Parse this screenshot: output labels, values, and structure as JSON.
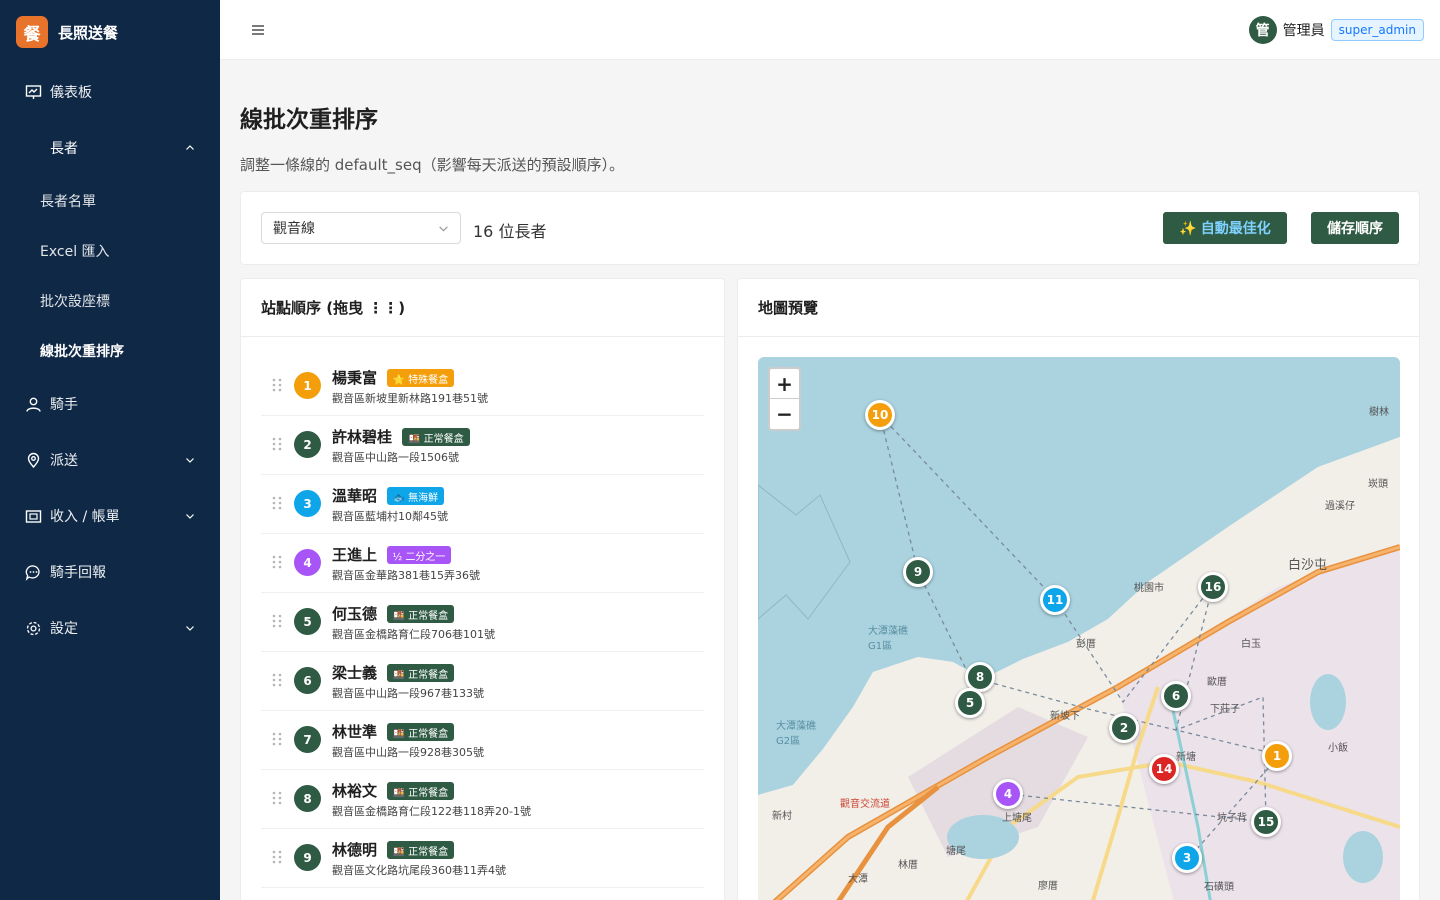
{
  "brand": {
    "logo_char": "餐",
    "name": "長照送餐"
  },
  "sidebar": {
    "dashboard": "儀表板",
    "elders_group": "長者",
    "elders_sub": [
      "長者名單",
      "Excel 匯入",
      "批次設座標",
      "線批次重排序"
    ],
    "riders": "騎手",
    "delivery": "派送",
    "billing": "收入 / 帳單",
    "rider_reports": "騎手回報",
    "settings": "設定"
  },
  "header": {
    "avatar_char": "管",
    "user_name": "管理員",
    "role": "super_admin"
  },
  "page": {
    "title": "線批次重排序",
    "description": "調整一條線的 default_seq（影響每天派送的預設順序）。"
  },
  "toolbar": {
    "route_select": "觀音線",
    "count_text": "16 位長者",
    "optimize_icon": "✨",
    "optimize_label": "自動最佳化",
    "save_label": "儲存順序"
  },
  "list_card": {
    "title": "站點順序 (拖曳 ⋮⋮)"
  },
  "stops": [
    {
      "seq": "1",
      "name": "楊秉富",
      "tag": "⭐ 特殊餐盒",
      "tag_color": "#f59e0b",
      "address": "觀音區新坡里新林路191巷51號",
      "color": "#f59e0b"
    },
    {
      "seq": "2",
      "name": "許林碧桂",
      "tag": "🍱 正常餐盒",
      "tag_color": "#2f5a43",
      "address": "觀音區中山路一段1506號",
      "color": "#2f5a43"
    },
    {
      "seq": "3",
      "name": "溫華昭",
      "tag": "🐟 無海鮮",
      "tag_color": "#0ea5e9",
      "address": "觀音區藍埔村10鄰45號",
      "color": "#0ea5e9"
    },
    {
      "seq": "4",
      "name": "王進上",
      "tag": "½ 二分之一",
      "tag_color": "#a855f7",
      "address": "觀音區金華路381巷15弄36號",
      "color": "#a855f7"
    },
    {
      "seq": "5",
      "name": "何玉德",
      "tag": "🍱 正常餐盒",
      "tag_color": "#2f5a43",
      "address": "觀音區金橋路育仁段706巷101號",
      "color": "#2f5a43"
    },
    {
      "seq": "6",
      "name": "梁士義",
      "tag": "🍱 正常餐盒",
      "tag_color": "#2f5a43",
      "address": "觀音區中山路一段967巷133號",
      "color": "#2f5a43"
    },
    {
      "seq": "7",
      "name": "林世準",
      "tag": "🍱 正常餐盒",
      "tag_color": "#2f5a43",
      "address": "觀音區中山路一段928巷305號",
      "color": "#2f5a43"
    },
    {
      "seq": "8",
      "name": "林裕文",
      "tag": "🍱 正常餐盒",
      "tag_color": "#2f5a43",
      "address": "觀音區金橋路育仁段122巷118弄20-1號",
      "color": "#2f5a43"
    },
    {
      "seq": "9",
      "name": "林德明",
      "tag": "🍱 正常餐盒",
      "tag_color": "#2f5a43",
      "address": "觀音區文化路坑尾段360巷11弄4號",
      "color": "#2f5a43"
    }
  ],
  "map_card": {
    "title": "地圖預覽",
    "zoom_in": "+",
    "zoom_out": "−"
  },
  "map_markers": [
    {
      "label": "10",
      "color": "#f59e0b"
    },
    {
      "label": "9",
      "color": "#2f5a43"
    },
    {
      "label": "11",
      "color": "#0ea5e9"
    },
    {
      "label": "16",
      "color": "#2f5a43"
    },
    {
      "label": "8",
      "color": "#2f5a43"
    },
    {
      "label": "5",
      "color": "#2f5a43"
    },
    {
      "label": "6",
      "color": "#2f5a43"
    },
    {
      "label": "2",
      "color": "#2f5a43"
    },
    {
      "label": "1",
      "color": "#f59e0b"
    },
    {
      "label": "14",
      "color": "#dc2626"
    },
    {
      "label": "4",
      "color": "#a855f7"
    },
    {
      "label": "15",
      "color": "#2f5a43"
    },
    {
      "label": "3",
      "color": "#0ea5e9"
    }
  ],
  "map_labels": [
    "白沙屯",
    "桃園市",
    "大潭藻礁G1區",
    "大潭藻礁G2區",
    "新坡下",
    "彭厝",
    "白玉",
    "歐厝",
    "下莊子",
    "坑子背",
    "塘尾",
    "新村",
    "觀音交流道",
    "大潭",
    "過溪仔",
    "樹林",
    "崁頭",
    "小飯",
    "林厝",
    "石磺頭",
    "廖厝",
    "上塘尾",
    "新塘"
  ]
}
